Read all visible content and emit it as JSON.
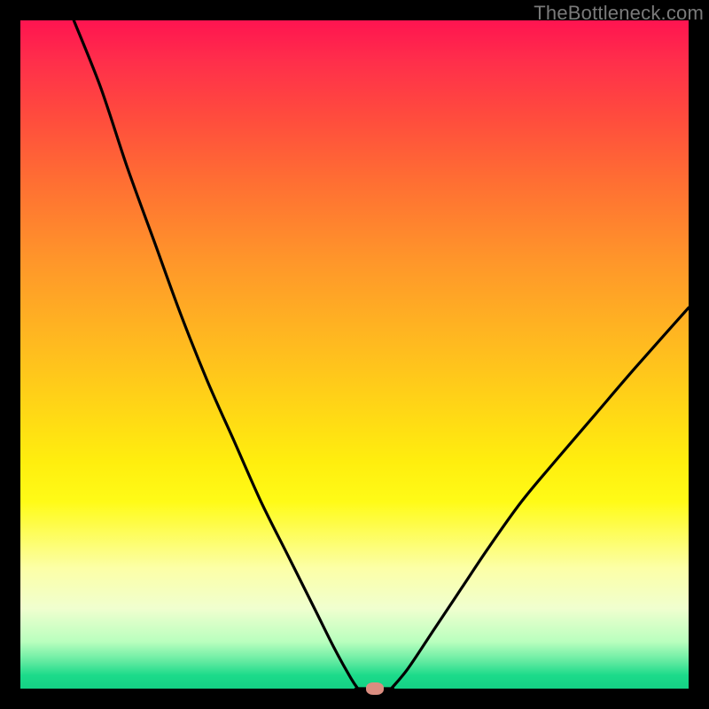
{
  "watermark_text": "TheBottleneck.com",
  "colors": {
    "curve_stroke": "#000000",
    "marker_fill": "#db8d80"
  },
  "chart_data": {
    "type": "line",
    "title": "",
    "xlabel": "",
    "ylabel": "",
    "xlim": [
      0,
      100
    ],
    "ylim": [
      0,
      100
    ],
    "axes_visible": false,
    "grid": false,
    "background": "vertical red-yellow-green gradient",
    "annotations": [
      {
        "kind": "marker",
        "x": 53,
        "y": 0,
        "label": "bottleneck-point"
      }
    ],
    "series": [
      {
        "name": "left-branch",
        "x": [
          8,
          12,
          16,
          20,
          24,
          28,
          32,
          36,
          40,
          44,
          47,
          49.5,
          50.5
        ],
        "values": [
          100,
          90,
          78,
          67,
          56,
          46,
          37,
          28,
          20,
          12,
          6,
          1.5,
          0
        ]
      },
      {
        "name": "floor",
        "x": [
          50.5,
          55.5
        ],
        "values": [
          0,
          0
        ]
      },
      {
        "name": "right-branch",
        "x": [
          55.5,
          58,
          62,
          66,
          70,
          75,
          80,
          86,
          92,
          100
        ],
        "values": [
          0,
          3,
          9,
          15,
          21,
          28,
          34,
          41,
          48,
          57
        ]
      }
    ]
  }
}
